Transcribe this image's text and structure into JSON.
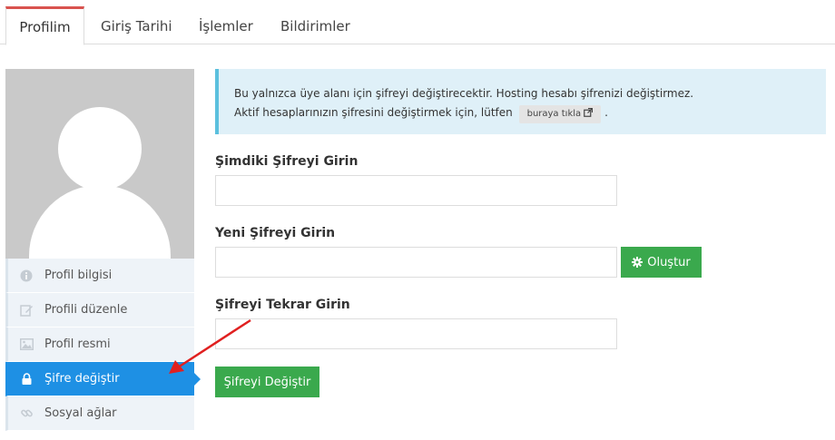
{
  "tabs": [
    {
      "label": "Profilim"
    },
    {
      "label": "Giriş Tarihi"
    },
    {
      "label": "İşlemler"
    },
    {
      "label": "Bildirimler"
    }
  ],
  "sidebar": {
    "items": [
      {
        "label": "Profil bilgisi",
        "icon": "info-icon"
      },
      {
        "label": "Profili düzenle",
        "icon": "edit-icon"
      },
      {
        "label": "Profil resmi",
        "icon": "image-icon"
      },
      {
        "label": "Şifre değiştir",
        "icon": "lock-icon",
        "active": true
      },
      {
        "label": "Sosyal ağlar",
        "icon": "link-icon"
      }
    ]
  },
  "alert": {
    "line1": "Bu yalnızca üye alanı için şifreyi değiştirecektir. Hosting hesabı şifrenizi değiştirmez.",
    "line2": "Aktif hesaplarınızın şifresini değiştirmek için, lütfen",
    "link_label": "buraya tıkla",
    "suffix": "."
  },
  "form": {
    "current_label": "Şimdiki Şifreyi Girin",
    "new_label": "Yeni Şifreyi Girin",
    "confirm_label": "Şifreyi Tekrar Girin",
    "generate_label": "Oluştur",
    "submit_label": "Şifreyi Değiştir"
  },
  "colors": {
    "accent_blue": "#1e90e4",
    "button_green": "#3aa94d",
    "tab_red": "#d9534f",
    "alert_bg": "#dff0f8",
    "arrow_red": "#e02020"
  }
}
